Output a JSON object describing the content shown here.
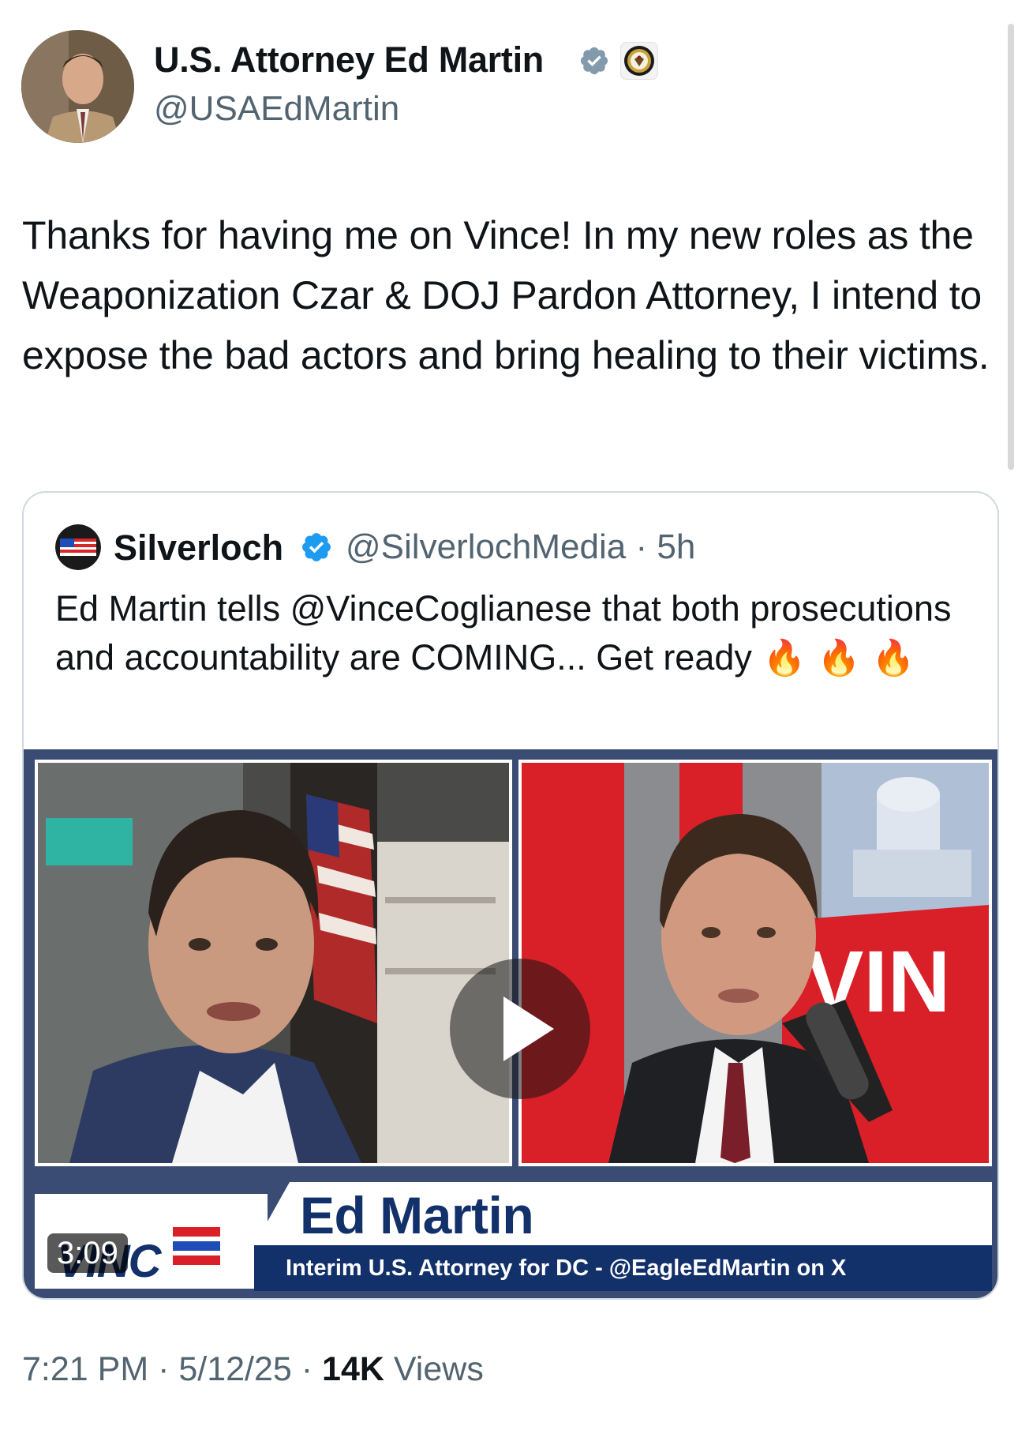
{
  "author": {
    "display_name": "U.S. Attorney Ed Martin",
    "handle": "@USAEdMartin"
  },
  "tweet": {
    "text": "Thanks for having me on Vince! In my new roles as the Weaponization Czar & DOJ Pardon Attorney, I intend to expose the bad actors and bring healing to their victims."
  },
  "quoted": {
    "name": "Silverloch",
    "handle": "@SilverlochMedia",
    "age": "5h",
    "text": "Ed Martin tells @VinceCoglianese that both prosecutions and accountability are COMING... Get ready",
    "emoji": "🔥"
  },
  "video": {
    "guest_name": "Ed Martin",
    "guest_title": "Interim U.S. Attorney for DC - @EagleEdMartin on X",
    "show_logo": "VINC",
    "studio_sign": "VIN",
    "duration": "3:09"
  },
  "meta": {
    "time": "7:21 PM",
    "date": "5/12/25",
    "views_count": "14K",
    "views_label": "Views"
  },
  "colors": {
    "verified_blue": "#1d9bf0",
    "navy": "#12306a",
    "muted_text": "#536471",
    "studio_red": "#d91f27"
  }
}
